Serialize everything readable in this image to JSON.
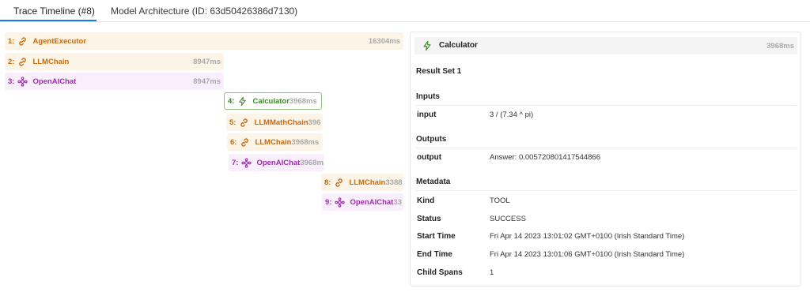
{
  "tabs": {
    "trace_timeline": "Trace Timeline (#8)",
    "model_architecture": "Model Architecture (ID: 63d50426386d7130)"
  },
  "spans": [
    {
      "idx": "1:",
      "name": "AgentExecutor",
      "duration": "16304ms",
      "kind": "chain",
      "icon": "link-icon"
    },
    {
      "idx": "2:",
      "name": "LLMChain",
      "duration": "8947ms",
      "kind": "chain",
      "icon": "link-icon"
    },
    {
      "idx": "3:",
      "name": "OpenAIChat",
      "duration": "8947ms",
      "kind": "llm",
      "icon": "llm-icon"
    },
    {
      "idx": "4:",
      "name": "Calculator",
      "duration": "3968ms",
      "kind": "tool",
      "icon": "lightning-icon"
    },
    {
      "idx": "5:",
      "name": "LLMMathChain",
      "duration": "396",
      "kind": "chain",
      "icon": "link-icon"
    },
    {
      "idx": "6:",
      "name": "LLMChain",
      "duration": "3968ms",
      "kind": "chain",
      "icon": "link-icon"
    },
    {
      "idx": "7:",
      "name": "OpenAIChat",
      "duration": "3968m",
      "kind": "llm",
      "icon": "llm-icon"
    },
    {
      "idx": "8:",
      "name": "LLMChain",
      "duration": "3388",
      "kind": "chain",
      "icon": "link-icon"
    },
    {
      "idx": "9:",
      "name": "OpenAIChat",
      "duration": "33",
      "kind": "llm",
      "icon": "llm-icon"
    }
  ],
  "detail": {
    "title": "Calculator",
    "duration": "3968ms",
    "icon": "lightning-icon",
    "result_set": "Result Set 1",
    "inputs_title": "Inputs",
    "input_key": "input",
    "input_value": "3 / (7.34 ^ pi)",
    "outputs_title": "Outputs",
    "output_key": "output",
    "output_value": "Answer: 0.005720801417544866",
    "metadata_title": "Metadata",
    "metadata": [
      {
        "key": "Kind",
        "value": "TOOL"
      },
      {
        "key": "Status",
        "value": "SUCCESS"
      },
      {
        "key": "Start Time",
        "value": "Fri Apr 14 2023 13:01:02 GMT+0100 (Irish Standard Time)"
      },
      {
        "key": "End Time",
        "value": "Fri Apr 14 2023 13:01:06 GMT+0100 (Irish Standard Time)"
      },
      {
        "key": "Child Spans",
        "value": "1"
      }
    ]
  },
  "colors": {
    "accent": "#1677ff",
    "chain": "#c36b0e",
    "llm": "#a02bb0",
    "tool": "#3d8a2a"
  }
}
